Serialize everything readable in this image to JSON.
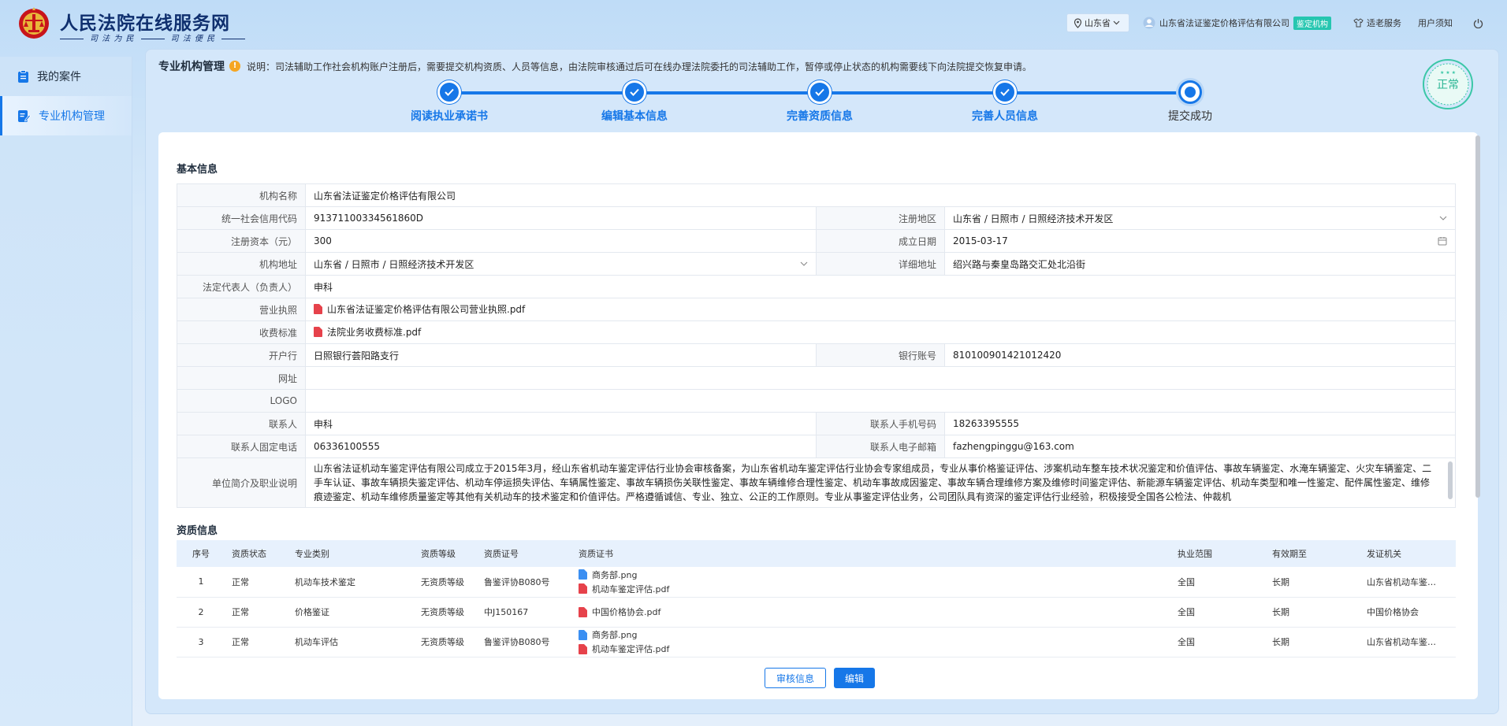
{
  "header": {
    "site_title": "人民法院在线服务网",
    "slogan_left": "司 法 为 民",
    "slogan_right": "司 法 便 民",
    "province": "山东省",
    "org_name": "山东省法证鉴定价格评估有限公司",
    "org_badge": "鉴定机构",
    "aged_service": "适老服务",
    "user_notice": "用户须知"
  },
  "sidebar": {
    "items": [
      {
        "label": "我的案件",
        "icon": "clipboard-icon"
      },
      {
        "label": "专业机构管理",
        "icon": "edit-doc-icon"
      }
    ]
  },
  "page": {
    "title": "专业机构管理",
    "note": "说明：司法辅助工作社会机构账户注册后，需要提交机构资质、人员等信息，由法院审核通过后可在线办理法院委托的司法辅助工作，暂停或停止状态的机构需要线下向法院提交恢复申请。",
    "status_stamp": "正常"
  },
  "steps": [
    {
      "label": "阅读执业承诺书",
      "done": true
    },
    {
      "label": "编辑基本信息",
      "done": true
    },
    {
      "label": "完善资质信息",
      "done": true
    },
    {
      "label": "完善人员信息",
      "done": true
    },
    {
      "label": "提交成功",
      "done": false
    }
  ],
  "basic": {
    "section_title": "基本信息",
    "name_k": "机构名称",
    "name_v": "山东省法证鉴定价格评估有限公司",
    "credit_k": "统一社会信用代码",
    "credit_v": "91371100334561860D",
    "region_k": "注册地区",
    "region_v": "山东省 / 日照市 / 日照经济技术开发区",
    "capital_k": "注册资本（元）",
    "capital_v": "300",
    "founded_k": "成立日期",
    "founded_v": "2015-03-17",
    "addr_k": "机构地址",
    "addr_v": "山东省 / 日照市 / 日照经济技术开发区",
    "detail_k": "详细地址",
    "detail_v": "绍兴路与秦皇岛路交汇处北沿街",
    "legal_k": "法定代表人（负责人）",
    "legal_v": "申科",
    "license_k": "营业执照",
    "license_v": "山东省法证鉴定价格评估有限公司营业执照.pdf",
    "fee_k": "收费标准",
    "fee_v": "法院业务收费标准.pdf",
    "bank_k": "开户行",
    "bank_v": "日照银行荟阳路支行",
    "account_k": "银行账号",
    "account_v": "810100901421012420",
    "web_k": "网址",
    "web_v": "",
    "logo_k": "LOGO",
    "logo_v": "",
    "contact_k": "联系人",
    "contact_v": "申科",
    "mobile_k": "联系人手机号码",
    "mobile_v": "18263395555",
    "phone_k": "联系人固定电话",
    "phone_v": "06336100555",
    "email_k": "联系人电子邮箱",
    "email_v": "fazhengpinggu@163.com",
    "intro_k": "单位简介及职业说明",
    "intro_v": "山东省法证机动车鉴定评估有限公司成立于2015年3月，经山东省机动车鉴定评估行业协会审核备案，为山东省机动车鉴定评估行业协会专家组成员，专业从事价格鉴证评估、涉案机动车整车技术状况鉴定和价值评估、事故车辆鉴定、水淹车辆鉴定、火灾车辆鉴定、二手车认证、事故车辆损失鉴定评估、机动车停运损失评估、车辆属性鉴定、事故车辆损伤关联性鉴定、事故车辆维修合理性鉴定、机动车事故成因鉴定、事故车辆合理维修方案及维修时间鉴定评估、新能源车辆鉴定评估、机动车类型和唯一性鉴定、配件属性鉴定、维修痕迹鉴定、机动车维修质量鉴定等其他有关机动车的技术鉴定和价值评估。严格遵循诚信、专业、独立、公正的工作原则。专业从事鉴定评估业务，公司团队具有资深的鉴定评估行业经验，积极接受全国各公检法、仲裁机"
  },
  "qualification": {
    "section_title": "资质信息",
    "headers": [
      "序号",
      "资质状态",
      "专业类别",
      "资质等级",
      "资质证号",
      "资质证书",
      "执业范围",
      "有效期至",
      "发证机关"
    ],
    "rows": [
      {
        "no": "1",
        "status": "正常",
        "category": "机动车技术鉴定",
        "level": "无资质等级",
        "cert_no": "鲁鉴评协B080号",
        "files": [
          {
            "name": "商务部.png",
            "type": "png"
          },
          {
            "name": "机动车鉴定评估.pdf",
            "type": "pdf"
          }
        ],
        "scope": "全国",
        "valid": "长期",
        "issuer": "山东省机动车鉴…"
      },
      {
        "no": "2",
        "status": "正常",
        "category": "价格鉴证",
        "level": "无资质等级",
        "cert_no": "中J150167",
        "files": [
          {
            "name": "中国价格协会.pdf",
            "type": "pdf"
          }
        ],
        "scope": "全国",
        "valid": "长期",
        "issuer": "中国价格协会"
      },
      {
        "no": "3",
        "status": "正常",
        "category": "机动车评估",
        "level": "无资质等级",
        "cert_no": "鲁鉴评协B080号",
        "files": [
          {
            "name": "商务部.png",
            "type": "png"
          },
          {
            "name": "机动车鉴定评估.pdf",
            "type": "pdf"
          }
        ],
        "scope": "全国",
        "valid": "长期",
        "issuer": "山东省机动车鉴…"
      }
    ]
  },
  "actions": {
    "review": "审核信息",
    "edit": "编辑"
  }
}
